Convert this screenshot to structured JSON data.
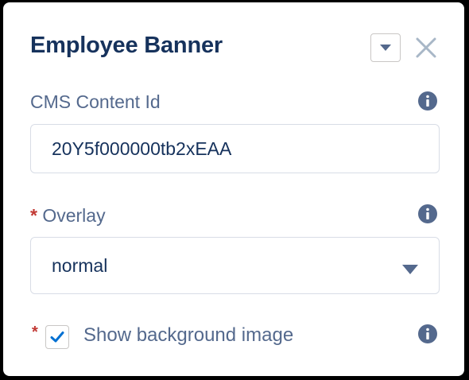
{
  "header": {
    "title": "Employee Banner"
  },
  "fields": {
    "cms_content_id": {
      "label": "CMS Content Id",
      "value": "20Y5f000000tb2xEAA"
    },
    "overlay": {
      "required_marker": "*",
      "label": "Overlay",
      "selected": "normal"
    },
    "show_background_image": {
      "required_marker": "*",
      "label": "Show background image",
      "checked": true
    }
  },
  "icons": {
    "dropdown": "chevron-down-icon",
    "close": "close-icon",
    "info": "info-icon",
    "checkmark": "checkmark-icon"
  },
  "colors": {
    "title": "#16325c",
    "label": "#54698d",
    "required": "#c23934",
    "accent": "#0070d2",
    "border": "#d8dde6"
  }
}
